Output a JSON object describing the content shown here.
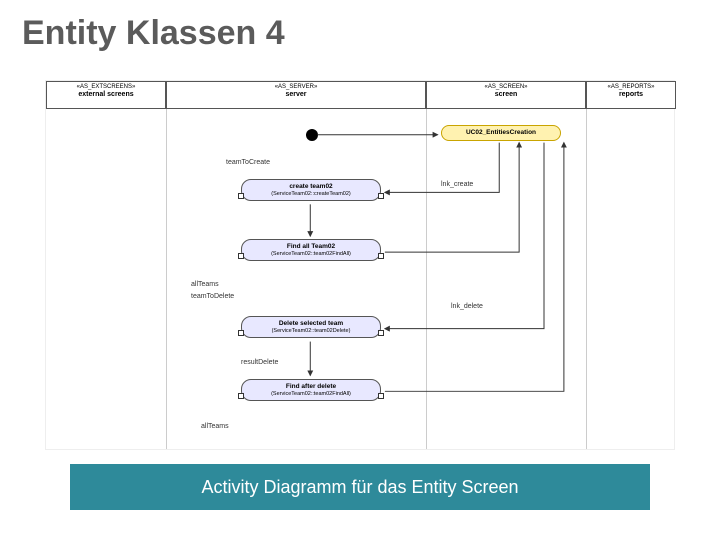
{
  "title": "Entity Klassen 4",
  "caption": "Activity Diagramm für das Entity Screen",
  "lanes": [
    {
      "stereo": "«AS_EXTSCREENS»",
      "name": "external screens"
    },
    {
      "stereo": "«AS_SERVER»",
      "name": "server"
    },
    {
      "stereo": "«AS_SCREEN»",
      "name": "screen"
    },
    {
      "stereo": "«AS_REPORTS»",
      "name": "reports"
    }
  ],
  "labels": {
    "teamToCreate": "teamToCreate",
    "lnk_create": "lnk_create",
    "lnk_delete": "lnk_delete",
    "allTeams": "allTeams",
    "teamToDelete": "teamToDelete",
    "resultDelete": "resultDelete",
    "allTeams2": "allTeams"
  },
  "activities": {
    "ucEntities": {
      "name": "UC02_EntitiesCreation",
      "desc": ""
    },
    "createTeam": {
      "name": "create team02",
      "desc": "(ServiceTeam02::createTeam02)"
    },
    "findAll": {
      "name": "Find all Team02",
      "desc": "(ServiceTeam02::team02FindAll)"
    },
    "deleteSel": {
      "name": "Delete selected team",
      "desc": "(ServiceTeam02::team02Delete)"
    },
    "findAfter": {
      "name": "Find after delete",
      "desc": "(ServiceTeam02::team02FindAll)"
    }
  },
  "colors": {
    "captionBg": "#2e8a9a",
    "titleColor": "#5b5b5b"
  }
}
